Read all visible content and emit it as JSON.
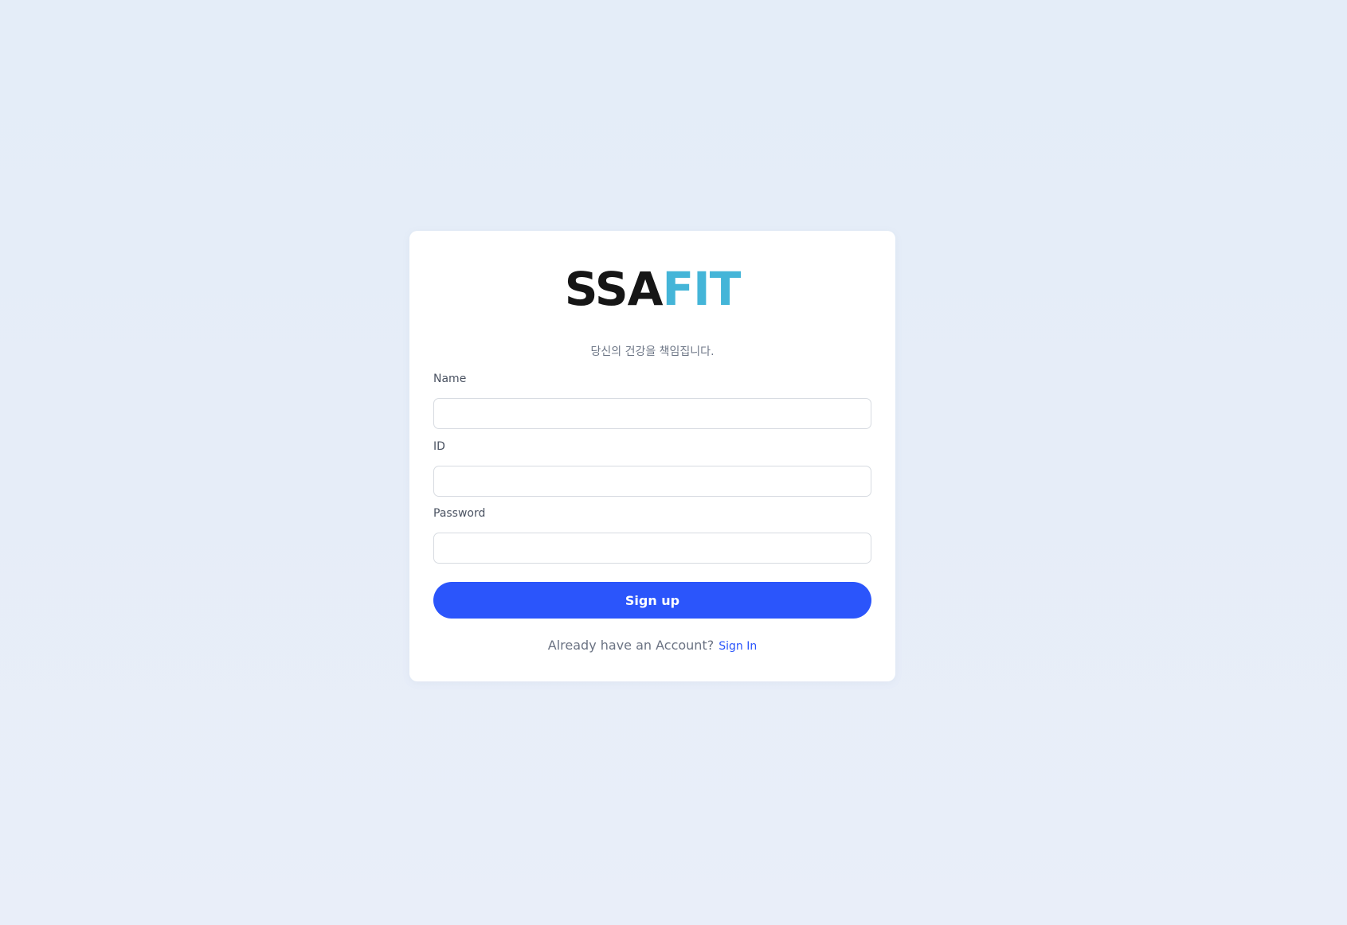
{
  "logo": {
    "part1": "SSA",
    "part2": "FIT",
    "color_dark": "#161616",
    "color_accent": "#44b5d8"
  },
  "tagline": "당신의 건강을 책임집니다.",
  "form": {
    "name_label": "Name",
    "name_value": "",
    "id_label": "ID",
    "id_value": "",
    "password_label": "Password",
    "password_value": "",
    "submit_label": "Sign up"
  },
  "footer": {
    "question": "Already have an Account?",
    "link_label": "Sign In"
  },
  "colors": {
    "primary": "#2b55fb",
    "background": "#e6edf8"
  }
}
